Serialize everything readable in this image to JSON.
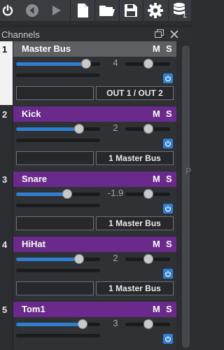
{
  "panel": {
    "title": "Channels"
  },
  "channels": [
    {
      "number": "1",
      "name": "Master Bus",
      "mute": "M",
      "solo": "S",
      "volume": "4",
      "volume_fraction": 0.83,
      "route": "OUT 1 / OUT 2",
      "header_color": "#5d5f63",
      "selected": true
    },
    {
      "number": "2",
      "name": "Kick",
      "mute": "M",
      "solo": "S",
      "volume": "2",
      "volume_fraction": 0.75,
      "route": "1 Master Bus",
      "header_color": "#6a2a8c",
      "selected": false
    },
    {
      "number": "3",
      "name": "Snare",
      "mute": "M",
      "solo": "S",
      "volume": "-1.9",
      "volume_fraction": 0.61,
      "route": "1 Master Bus",
      "header_color": "#6a2a8c",
      "selected": false
    },
    {
      "number": "4",
      "name": "HiHat",
      "mute": "M",
      "solo": "S",
      "volume": "2",
      "volume_fraction": 0.75,
      "route": "1 Master Bus",
      "header_color": "#6a2a8c",
      "selected": false
    },
    {
      "number": "5",
      "name": "Tom1",
      "mute": "M",
      "solo": "S",
      "volume": "3",
      "volume_fraction": 0.79,
      "route": "",
      "header_color": "#6a2a8c",
      "selected": false
    }
  ],
  "scrollbar": {
    "side_letter": "P"
  },
  "colors": {
    "accent": "#2e7fd6",
    "channel_purple": "#6a2a8c",
    "master_gray": "#5d5f63"
  },
  "toolbar_icons": [
    "power-icon",
    "rewind-icon",
    "play-icon",
    "new-file-icon",
    "open-folder-icon",
    "save-icon",
    "gear-icon",
    "database-icon"
  ]
}
